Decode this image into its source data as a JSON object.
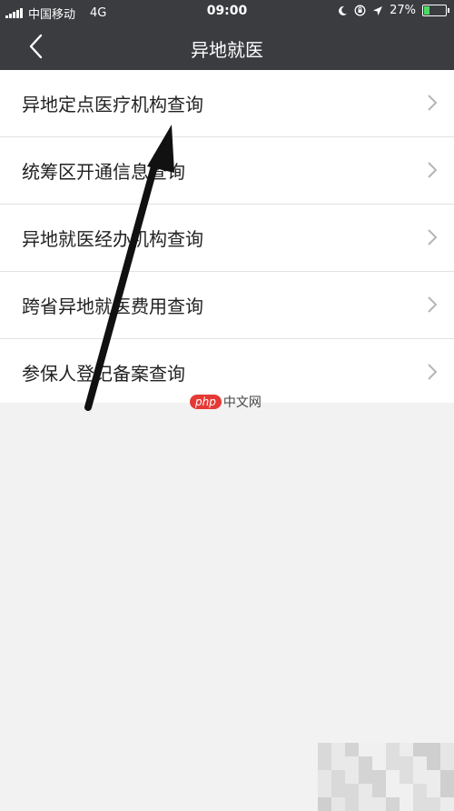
{
  "status_bar": {
    "carrier": "中国移动",
    "network": "4G",
    "time": "09:00",
    "battery_percent": "27%",
    "battery_level": 0.27
  },
  "nav": {
    "title": "异地就医"
  },
  "menu": {
    "items": [
      {
        "label": "异地定点医疗机构查询"
      },
      {
        "label": "统筹区开通信息查询"
      },
      {
        "label": "异地就医经办机构查询"
      },
      {
        "label": "跨省异地就医费用查询"
      },
      {
        "label": "参保人登记备案查询"
      }
    ]
  },
  "watermark": {
    "logo": "php",
    "text": "中文网"
  },
  "colors": {
    "header_bg": "#3b3c40",
    "page_bg": "#f2f2f2",
    "battery_fill": "#4cd964"
  }
}
